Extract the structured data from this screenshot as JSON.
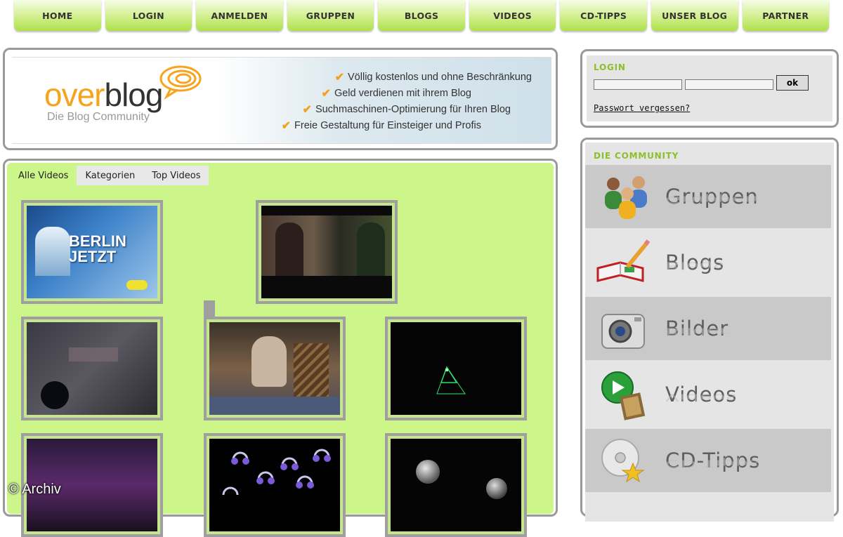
{
  "nav": {
    "items": [
      "HOME",
      "LOGIN",
      "ANMELDEN",
      "GRUPPEN",
      "BLOGS",
      "VIDEOS",
      "CD-TIPPS",
      "UNSER BLOG",
      "PARTNER"
    ]
  },
  "banner": {
    "logo_over": "over",
    "logo_blog": "blog",
    "logo_sub": "Die Blog Community",
    "features": [
      "Völlig kostenlos und ohne Beschränkung",
      "Geld verdienen mit ihrem Blog",
      "Suchmaschinen-Optimierung für Ihren Blog",
      "Freie Gestaltung für Einsteiger und Profis"
    ]
  },
  "video_tabs": [
    "Alle Videos",
    "Kategorien",
    "Top Videos"
  ],
  "thumb_texts": {
    "berlin_line1": "BERLIN",
    "berlin_line2": "JETZT"
  },
  "login": {
    "title": "LOGIN",
    "ok_label": "ok",
    "forgot_label": "Passwort vergessen?"
  },
  "community": {
    "title": "DIE COMMUNITY",
    "items": [
      {
        "label": "Gruppen",
        "icon": "people-icon"
      },
      {
        "label": "Blogs",
        "icon": "book-pencil-icon"
      },
      {
        "label": "Bilder",
        "icon": "camera-icon"
      },
      {
        "label": "Videos",
        "icon": "film-play-icon"
      },
      {
        "label": "CD-Tipps",
        "icon": "cd-star-icon"
      }
    ]
  },
  "watermark": "© Archiv",
  "colors": {
    "nav_green": "#aee04a",
    "panel_green": "#ccf68a",
    "accent_green": "#8cbf2a",
    "logo_orange": "#f7a31c"
  }
}
